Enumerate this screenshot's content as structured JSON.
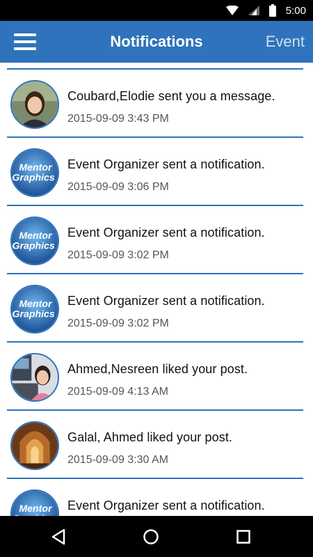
{
  "status_bar": {
    "time": "5:00",
    "icons": [
      "wifi-icon",
      "signal-icon",
      "battery-icon"
    ]
  },
  "app_bar": {
    "menu_icon": "hamburger-menu-icon",
    "title": "Notifications",
    "action_label": "Event",
    "color": "#2e73bb"
  },
  "notifications": [
    {
      "avatar": "photo-woman",
      "message": "Coubard,Elodie  sent you a message.",
      "timestamp": "2015-09-09 3:43 PM"
    },
    {
      "avatar": "mentor-graphics-logo",
      "message": "Event Organizer sent a notification.",
      "timestamp": "2015-09-09 3:06 PM"
    },
    {
      "avatar": "mentor-graphics-logo",
      "message": "Event Organizer sent a notification.",
      "timestamp": "2015-09-09 3:02 PM"
    },
    {
      "avatar": "mentor-graphics-logo",
      "message": "Event Organizer sent a notification.",
      "timestamp": "2015-09-09 3:02 PM"
    },
    {
      "avatar": "photo-woman-desk",
      "message": "Ahmed,Nesreen liked your post.",
      "timestamp": "2015-09-09 4:13 AM"
    },
    {
      "avatar": "photo-mosque-interior",
      "message": "Galal, Ahmed liked your post.",
      "timestamp": "2015-09-09 3:30 AM"
    },
    {
      "avatar": "mentor-graphics-logo",
      "message": "Event Organizer sent a notification.",
      "timestamp": ""
    }
  ],
  "nav_bar": {
    "icons": [
      "back-icon",
      "home-icon",
      "recents-icon"
    ]
  }
}
